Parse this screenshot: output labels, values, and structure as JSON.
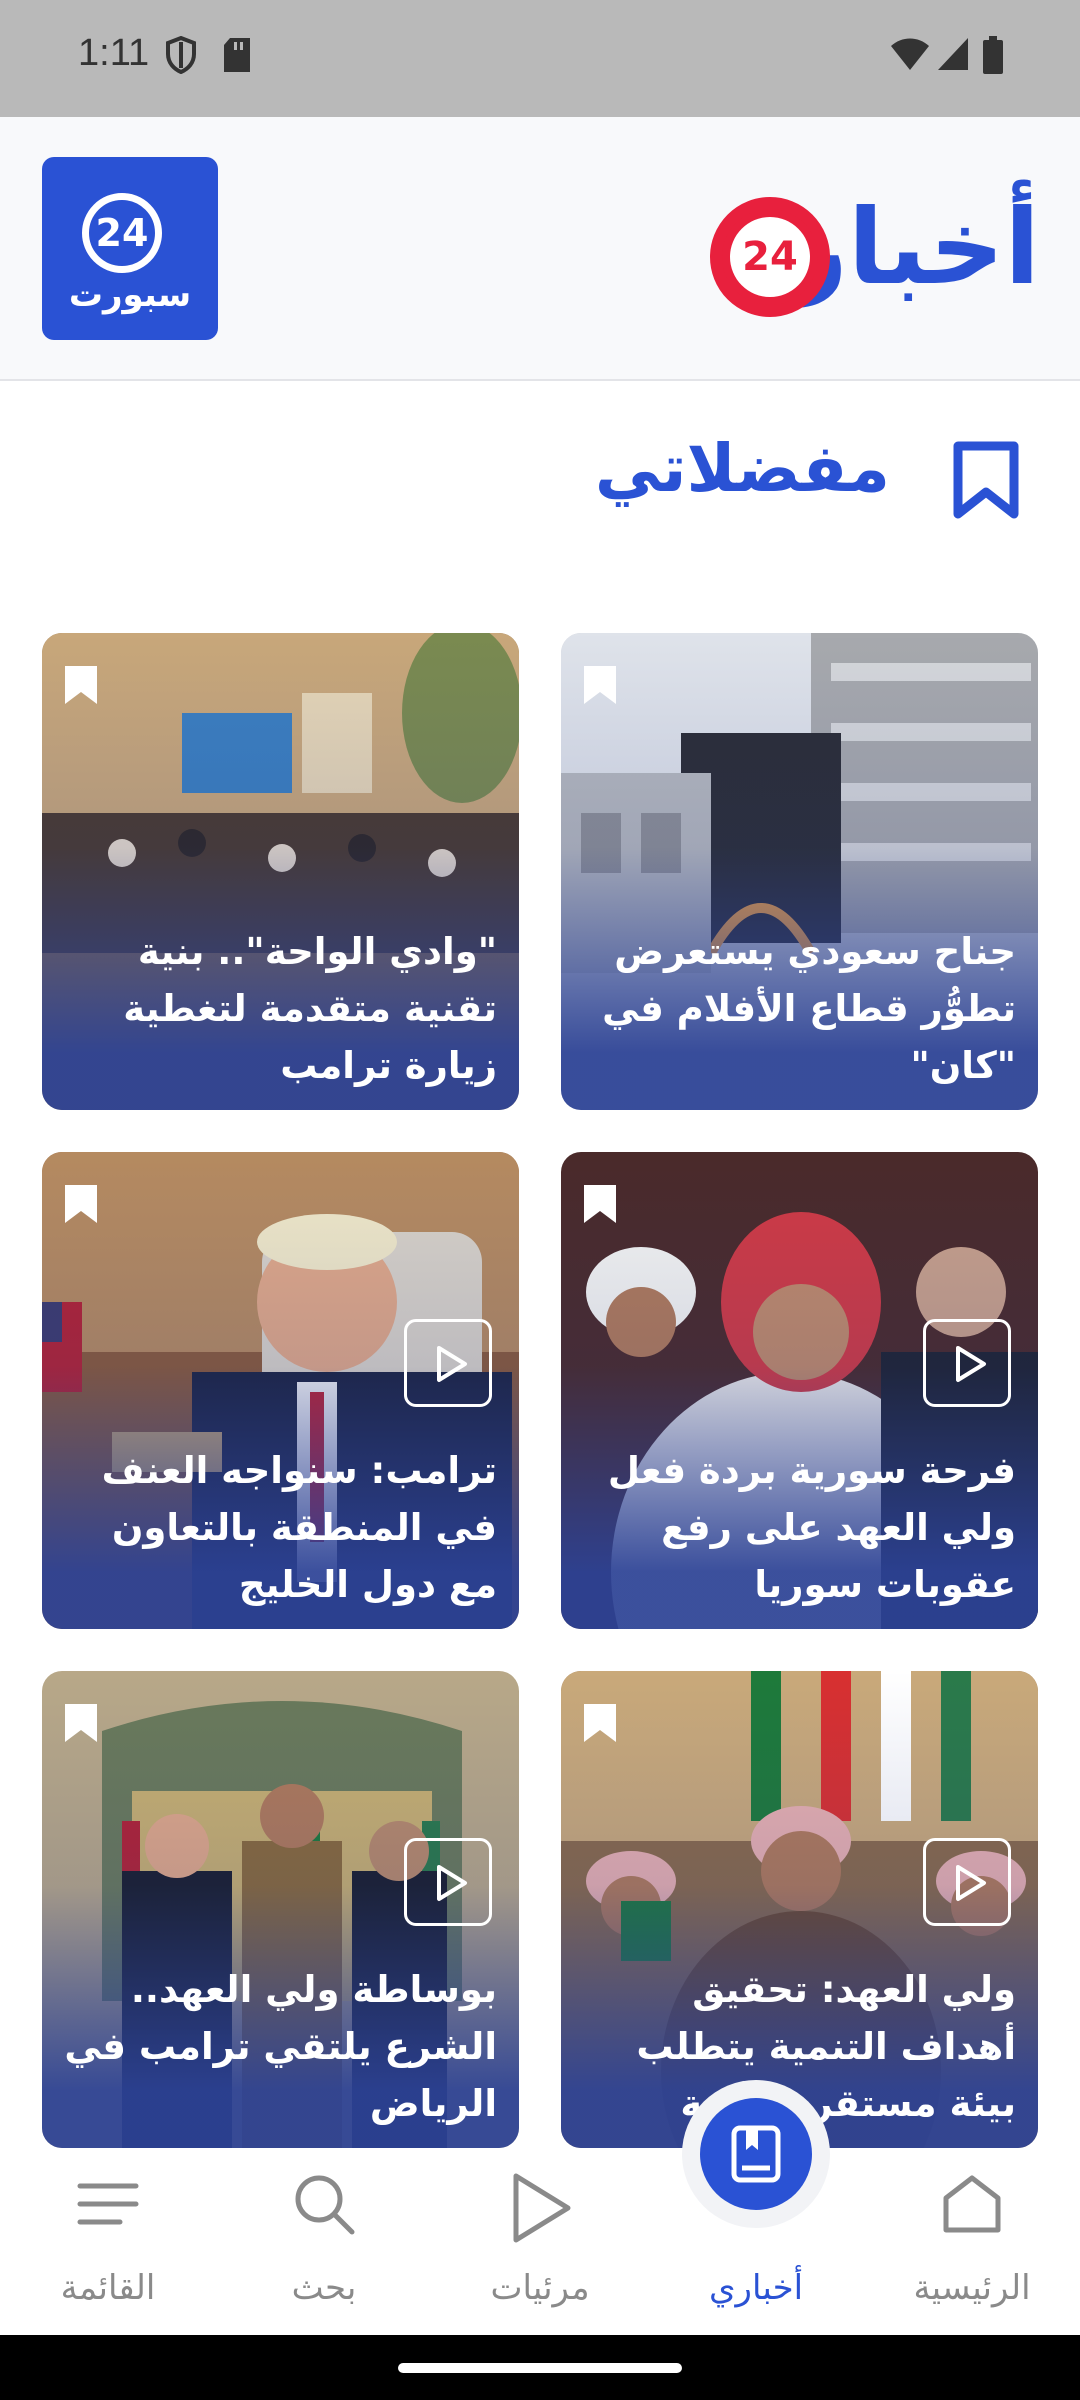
{
  "status_bar": {
    "time": "1:11"
  },
  "header": {
    "sport_logo": {
      "number": "24",
      "text": "سبورت"
    },
    "brand_logo": {
      "word": "أخبار",
      "number": "24"
    }
  },
  "page": {
    "title": "مفضلاتي"
  },
  "cards": [
    {
      "headline": "جناح سعودي يستعرض تطوُّر قطاع الأفلام في \"كان\"",
      "video": false
    },
    {
      "headline": "\"وادي الواحة\".. بنية تقنية متقدمة لتغطية زيارة ترامب",
      "video": false
    },
    {
      "headline": "فرحة سورية بردة فعل ولي العهد على رفع عقوبات سوريا",
      "video": true
    },
    {
      "headline": "ترامب: سنواجه العنف في المنطقة بالتعاون مع دول الخليج",
      "video": true
    },
    {
      "headline": "ولي العهد: تحقيق أهداف التنمية يتطلب بيئة مستقرة وآمنة",
      "video": true
    },
    {
      "headline": "بوساطة ولي العهد.. الشرع يلتقي ترامب في الرياض",
      "video": true
    }
  ],
  "bottom_nav": {
    "items": [
      {
        "label": "القائمة",
        "icon": "menu-icon",
        "active": false
      },
      {
        "label": "بحث",
        "icon": "search-icon",
        "active": false
      },
      {
        "label": "مرئيات",
        "icon": "play-icon",
        "active": false
      },
      {
        "label": "أخباري",
        "icon": "bookmark-book-icon",
        "active": true
      },
      {
        "label": "الرئيسية",
        "icon": "home-icon",
        "active": false
      }
    ]
  },
  "colors": {
    "brand_blue": "#2a52d4",
    "brand_red": "#e8203d",
    "nav_gray": "#8a8a8a"
  }
}
